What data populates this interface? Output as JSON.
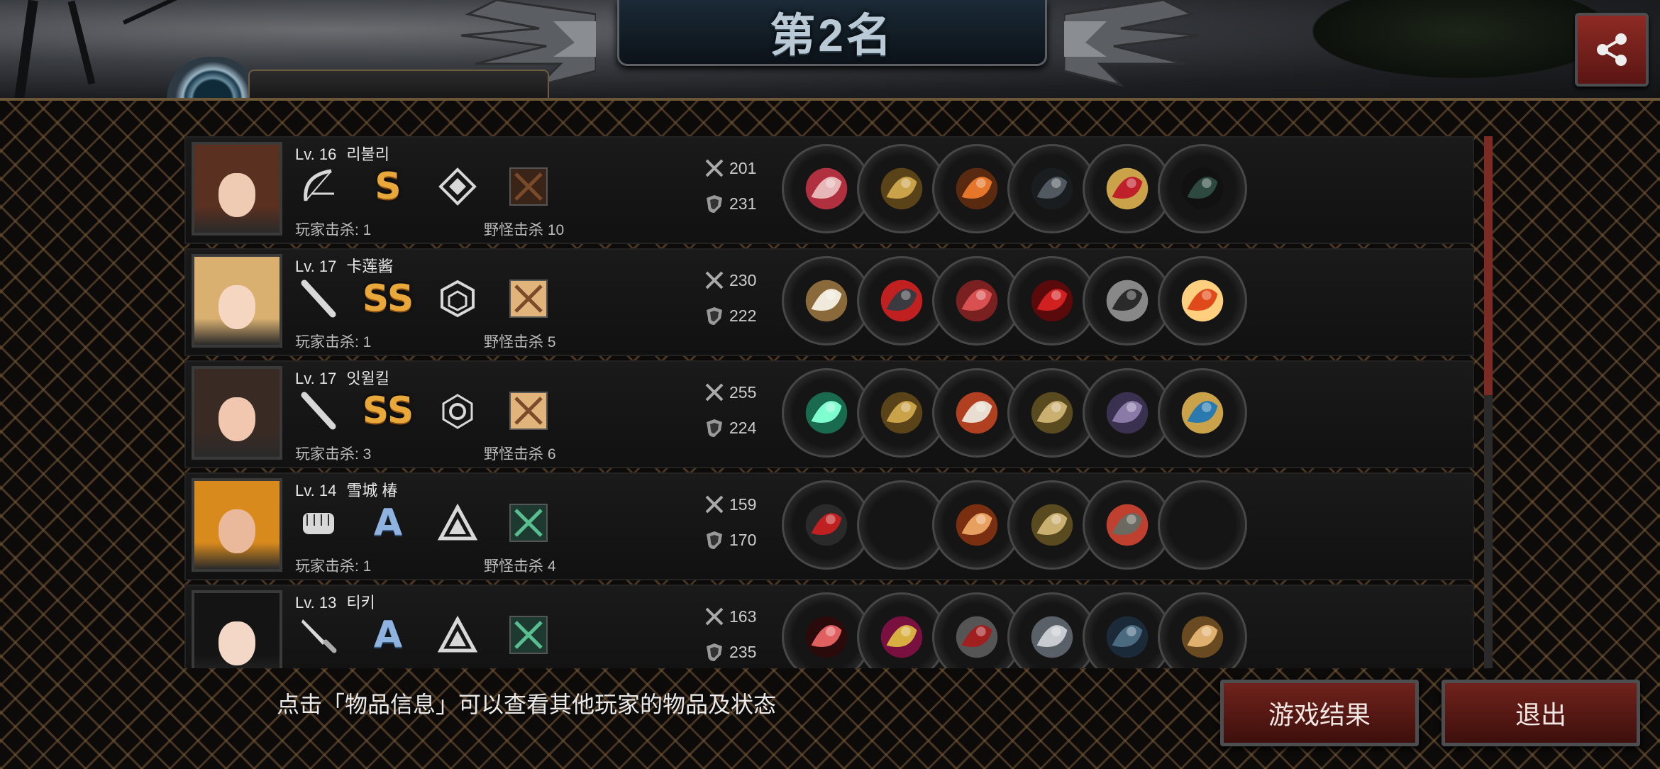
{
  "header": {
    "title": "第2名",
    "profile_name": ""
  },
  "players": [
    {
      "level": "Lv. 16",
      "name": "리불리",
      "rank": "S",
      "weapon_icon": "bow-icon",
      "class_icon": "diamond-class-icon",
      "player_kills": "玩家击杀: 1",
      "monster_kills": "野怪击杀 10",
      "attack": "201",
      "defense": "231",
      "items": [
        "bow-item",
        "golden-helmet-item",
        "flame-armor-item",
        "dark-gauntlet-item",
        "red-heels-item",
        "dark-baton-item"
      ]
    },
    {
      "level": "Lv. 17",
      "name": "卡莲酱",
      "rank": "SS",
      "weapon_icon": "bat-icon",
      "class_icon": "hex-class-icon",
      "player_kills": "玩家击杀: 1",
      "monster_kills": "野怪击杀 5",
      "attack": "230",
      "defense": "222",
      "items": [
        "fan-item",
        "black-helmet-item",
        "red-jacket-item",
        "ruby-brooch-item",
        "black-boots-item",
        "red-dice-item"
      ]
    },
    {
      "level": "Lv. 17",
      "name": "잇윌킬",
      "rank": "SS",
      "weapon_icon": "bat-icon",
      "class_icon": "circle-class-icon",
      "player_kills": "玩家击杀: 3",
      "monster_kills": "野怪击杀 6",
      "attack": "255",
      "defense": "224",
      "items": [
        "light-saber-item",
        "golden-helmet-item",
        "fur-coat-item",
        "gold-shield-item",
        "purple-boots-item",
        "sapphire-earring-item"
      ]
    },
    {
      "level": "Lv. 14",
      "name": "雪城 椿",
      "rank": "A",
      "weapon_icon": "fist-icon",
      "class_icon": "triangle-class-icon",
      "player_kills": "玩家击杀: 1",
      "monster_kills": "野怪击杀 4",
      "attack": "159",
      "defense": "170",
      "items": [
        "red-goggles-item",
        "",
        "grape-arm-item",
        "gold-shield-item",
        "armored-boots-item",
        ""
      ]
    },
    {
      "level": "Lv. 13",
      "name": "티키",
      "rank": "A",
      "weapon_icon": "knife-icon",
      "class_icon": "triangle-class-icon",
      "player_kills": "",
      "monster_kills": "",
      "attack": "163",
      "defense": "235",
      "items": [
        "crimson-blade-item",
        "crown-item",
        "red-mail-item",
        "silver-bracer-item",
        "blue-boots-item",
        "portrait-fan-item"
      ]
    }
  ],
  "footer": {
    "hint": "点击「物品信息」可以查看其他玩家的物品及状态",
    "result_button": "游戏结果",
    "exit_button": "退出"
  },
  "colors": {
    "accent_red": "#70221c",
    "rank_gold": "#e9a83a",
    "rank_blue": "#8fb3e0"
  }
}
